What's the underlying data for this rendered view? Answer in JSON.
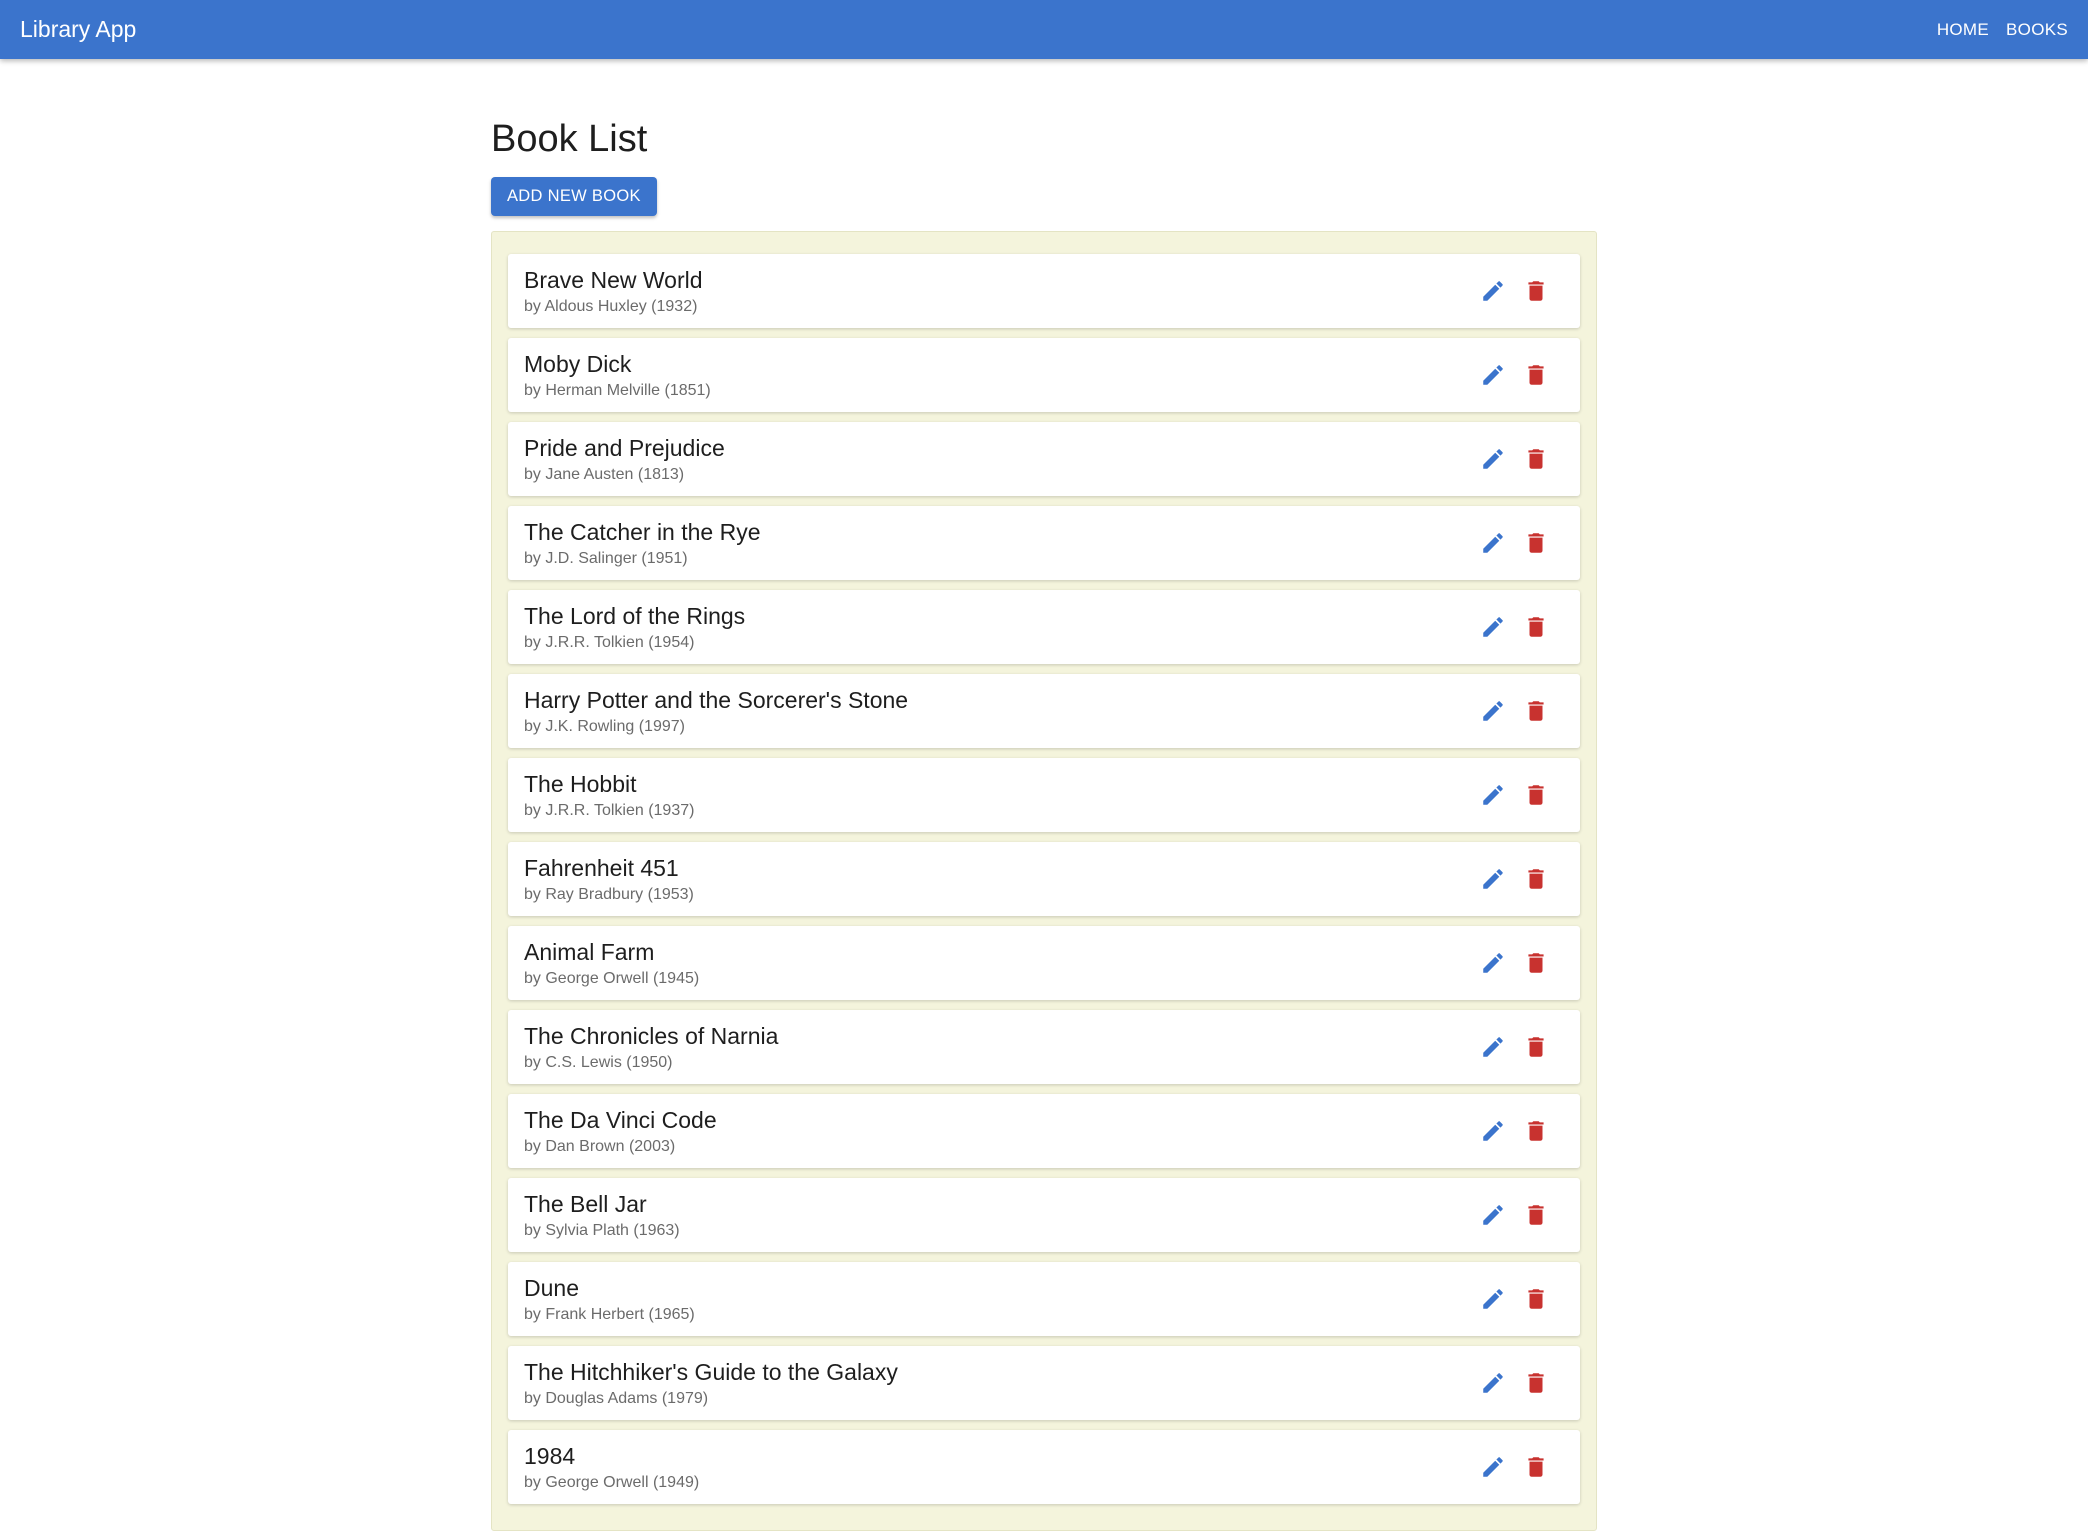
{
  "app_bar": {
    "title": "Library App",
    "nav": [
      {
        "label": "HOME"
      },
      {
        "label": "BOOKS"
      }
    ]
  },
  "colors": {
    "primary": "#3b74cc",
    "edit_icon": "#3b74cc",
    "delete_icon": "#c8322f",
    "panel_background": "#f4f4dc"
  },
  "page": {
    "title": "Book List",
    "add_button_label": "ADD NEW BOOK"
  },
  "icons": {
    "edit": "pencil-icon",
    "delete": "trash-icon"
  },
  "books": [
    {
      "title": "Brave New World",
      "subtitle": "by Aldous Huxley (1932)"
    },
    {
      "title": "Moby Dick",
      "subtitle": "by Herman Melville (1851)"
    },
    {
      "title": "Pride and Prejudice",
      "subtitle": "by Jane Austen (1813)"
    },
    {
      "title": "The Catcher in the Rye",
      "subtitle": "by J.D. Salinger (1951)"
    },
    {
      "title": "The Lord of the Rings",
      "subtitle": "by J.R.R. Tolkien (1954)"
    },
    {
      "title": "Harry Potter and the Sorcerer's Stone",
      "subtitle": "by J.K. Rowling (1997)"
    },
    {
      "title": "The Hobbit",
      "subtitle": "by J.R.R. Tolkien (1937)"
    },
    {
      "title": "Fahrenheit 451",
      "subtitle": "by Ray Bradbury (1953)"
    },
    {
      "title": "Animal Farm",
      "subtitle": "by George Orwell (1945)"
    },
    {
      "title": "The Chronicles of Narnia",
      "subtitle": "by C.S. Lewis (1950)"
    },
    {
      "title": "The Da Vinci Code",
      "subtitle": "by Dan Brown (2003)"
    },
    {
      "title": "The Bell Jar",
      "subtitle": "by Sylvia Plath (1963)"
    },
    {
      "title": "Dune",
      "subtitle": "by Frank Herbert (1965)"
    },
    {
      "title": "The Hitchhiker's Guide to the Galaxy",
      "subtitle": "by Douglas Adams (1979)"
    },
    {
      "title": "1984",
      "subtitle": "by George Orwell (1949)"
    }
  ]
}
